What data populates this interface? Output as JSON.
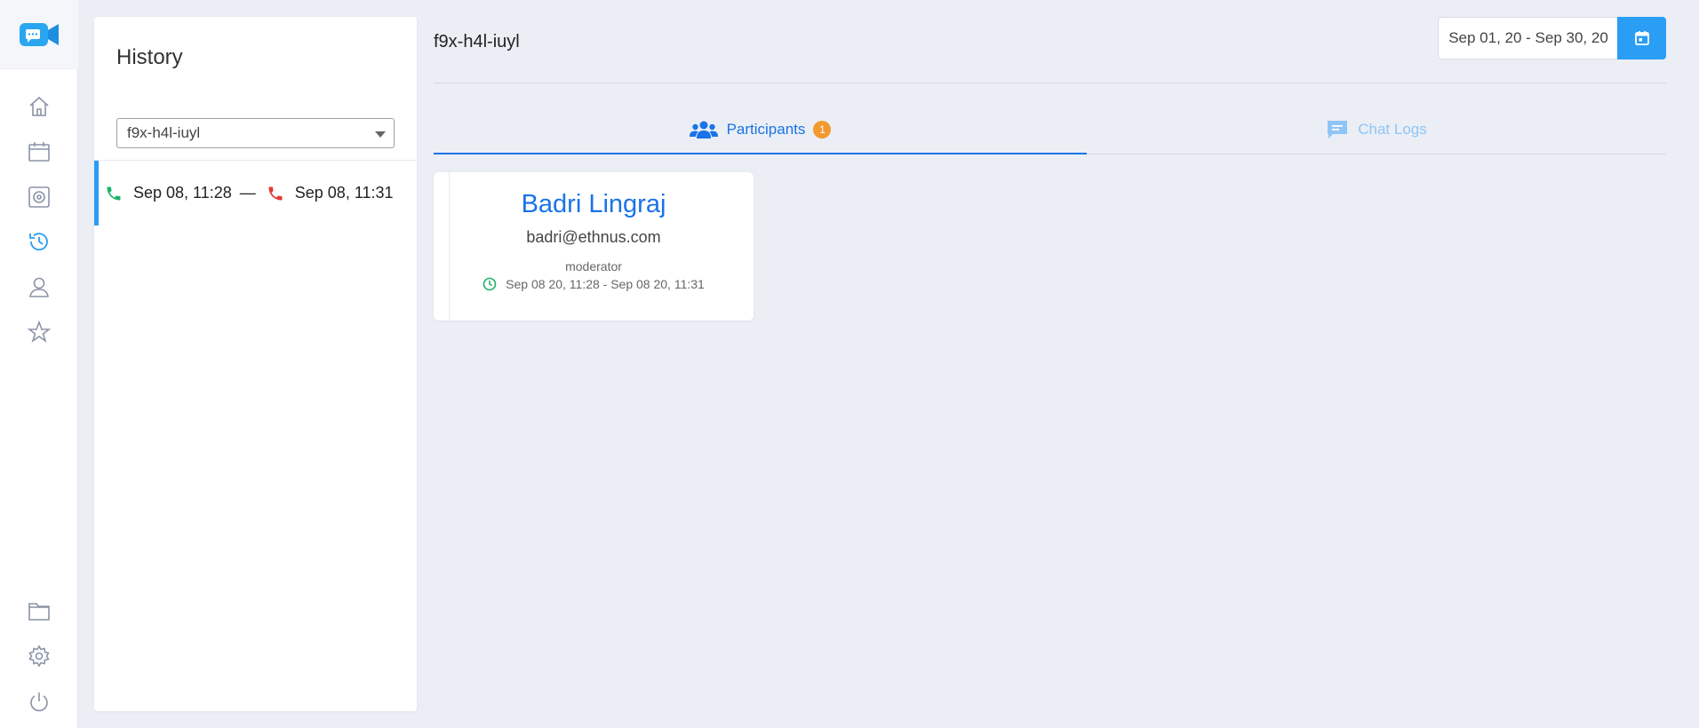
{
  "sidebar": {
    "logo": "video-camera-logo",
    "items": [
      {
        "name": "home",
        "icon": "home-icon",
        "active": false
      },
      {
        "name": "calendar",
        "icon": "calendar-icon",
        "active": false
      },
      {
        "name": "recordings",
        "icon": "record-icon",
        "active": false
      },
      {
        "name": "history",
        "icon": "history-icon",
        "active": true
      },
      {
        "name": "users",
        "icon": "user-icon",
        "active": false
      },
      {
        "name": "favorites",
        "icon": "star-icon",
        "active": false
      },
      {
        "name": "files",
        "icon": "folder-icon",
        "active": false
      },
      {
        "name": "settings",
        "icon": "gear-icon",
        "active": false
      },
      {
        "name": "logout",
        "icon": "power-icon",
        "active": false
      }
    ]
  },
  "history": {
    "title": "History",
    "selected_room": "f9x-h4l-iuyl",
    "sessions": [
      {
        "start": "Sep 08, 11:28",
        "separator": "—",
        "end": "Sep 08, 11:31"
      }
    ]
  },
  "main": {
    "room_title": "f9x-h4l-iuyl",
    "date_range": "Sep 01, 20 - Sep 30, 20",
    "tabs": [
      {
        "label": "Participants",
        "badge": "1",
        "active": true
      },
      {
        "label": "Chat Logs",
        "active": false
      }
    ],
    "participants": [
      {
        "name": "Badri Lingraj",
        "email": "badri@ethnus.com",
        "role": "moderator",
        "time": "Sep 08 20, 11:28 - Sep 08 20, 11:31"
      }
    ]
  },
  "colors": {
    "accent": "#1a73e8",
    "primary_button": "#2a9df4",
    "badge": "#f29a2e",
    "call_start": "#1db36a",
    "call_end": "#e53935",
    "background": "#ebeef5"
  }
}
